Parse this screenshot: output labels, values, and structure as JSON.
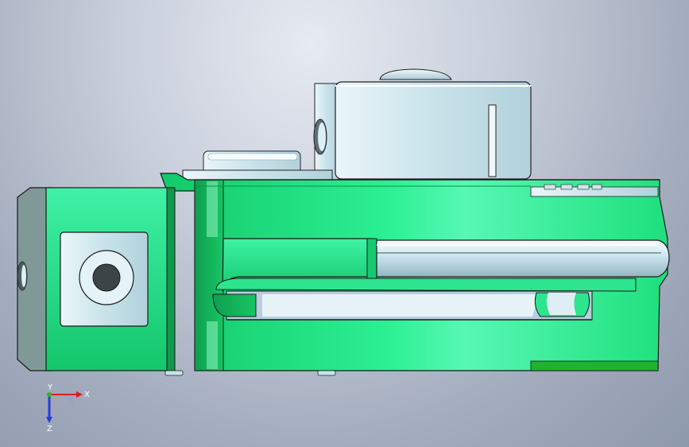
{
  "view": {
    "background_top": "#e6eaf2",
    "background_bottom": "#8f99ac"
  },
  "part": {
    "body_color": "#22e08a",
    "accent_green": "#19b83a",
    "steel_color": "#c7e3ea"
  },
  "triad": {
    "x_label": "X",
    "y_label": "Y",
    "z_label": "Z",
    "x_color": "#e11b1b",
    "y_color": "#1fbf2b",
    "z_color": "#2a3cd9"
  }
}
